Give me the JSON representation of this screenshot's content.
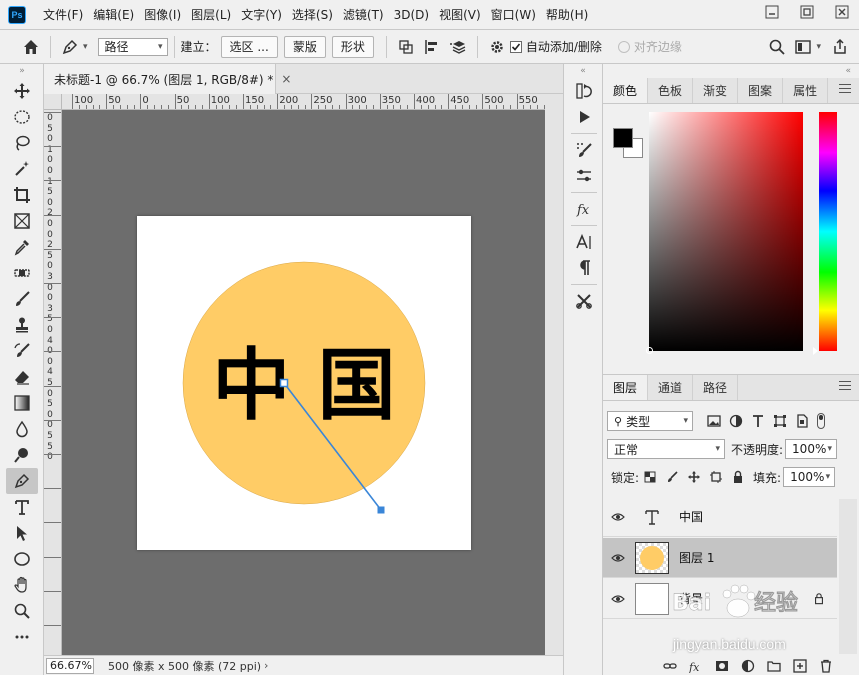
{
  "app": {
    "logo_text": "Ps",
    "menu": [
      "文件(F)",
      "编辑(E)",
      "图像(I)",
      "图层(L)",
      "文字(Y)",
      "选择(S)",
      "滤镜(T)",
      "3D(D)",
      "视图(V)",
      "窗口(W)",
      "帮助(H)"
    ]
  },
  "options_bar": {
    "mode_value": "路径",
    "make_label": "建立：",
    "selection_btn": "选区 ...",
    "mask_btn": "蒙版",
    "shape_btn": "形状",
    "auto_add_delete_label": "自动添加/删除",
    "align_edges_label": "对齐边缘"
  },
  "document": {
    "tab_title": "未标题-1 @ 66.7% (图层 1, RGB/8#) *",
    "tab_close": "×",
    "artwork_text": "中 国",
    "circle_color": "#ffcc66",
    "path_color": "#3a86d8"
  },
  "rulers": {
    "h_labels": [
      "100",
      "50",
      "0",
      "50",
      "100",
      "150",
      "200",
      "250",
      "300",
      "350",
      "400",
      "450",
      "500",
      "550"
    ],
    "v_labels": [
      "0",
      "5",
      "0",
      "1",
      "0",
      "0",
      "1",
      "5",
      "0",
      "2",
      "0",
      "0",
      "2",
      "5",
      "0",
      "3",
      "0",
      "0",
      "3",
      "5",
      "0",
      "4",
      "0",
      "0",
      "4",
      "5",
      "0",
      "5",
      "0",
      "0",
      "5",
      "5",
      "0"
    ]
  },
  "status": {
    "zoom": "66.67%",
    "doc_info": "500 像素 x 500 像素 (72 ppi)",
    "arrow": "›"
  },
  "color_panel": {
    "tabs": [
      "颜色",
      "色板",
      "渐变",
      "图案",
      "属性"
    ],
    "active_tab": 0
  },
  "layers_panel": {
    "tabs": [
      "图层",
      "通道",
      "路径"
    ],
    "filter_value": "类型",
    "blend_mode": "正常",
    "opacity_label": "不透明度:",
    "opacity_value": "100%",
    "lock_label": "锁定:",
    "fill_label": "填充:",
    "fill_value": "100%",
    "layers": [
      {
        "name": "中国",
        "type": "text",
        "selected": false
      },
      {
        "name": "图层 1",
        "type": "raster",
        "selected": true
      },
      {
        "name": "背景",
        "type": "background",
        "selected": false
      }
    ]
  },
  "watermark": {
    "url_text": "jingyan.baidu.com"
  }
}
